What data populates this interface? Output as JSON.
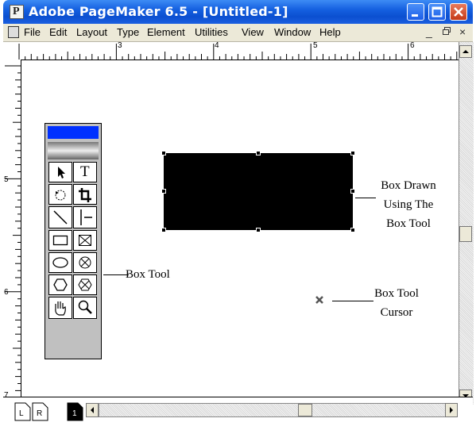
{
  "window": {
    "title": "Adobe PageMaker 6.5 - [Untitled-1]",
    "app_icon_letter": "P",
    "controls": [
      "minimize-icon",
      "maximize-icon",
      "close-icon"
    ]
  },
  "menubar": {
    "items": [
      "File",
      "Edit",
      "Layout",
      "Type",
      "Element",
      "Utilities",
      "View",
      "Window",
      "Help"
    ],
    "mdi_controls": [
      "_",
      "ɤ",
      "×"
    ]
  },
  "ruler": {
    "horizontal_labels": [
      "3",
      "4",
      "5",
      "6"
    ],
    "vertical_labels": [
      "5",
      "6",
      "7"
    ]
  },
  "toolbox": {
    "tools": [
      "pointer-tool",
      "text-tool",
      "rotate-tool",
      "crop-tool",
      "line-tool",
      "constrained-line-tool",
      "rectangle-tool",
      "rectangle-frame-tool",
      "ellipse-tool",
      "ellipse-frame-tool",
      "polygon-tool",
      "polygon-frame-tool",
      "hand-tool",
      "zoom-tool"
    ],
    "text_tool_glyph": "T"
  },
  "annotations": {
    "box_drawn": [
      "Box Drawn",
      "Using The",
      "Box Tool"
    ],
    "box_tool": "Box Tool",
    "box_tool_cursor": [
      "Box Tool",
      "Cursor"
    ]
  },
  "pages": {
    "left": "L",
    "right": "R",
    "current": "1"
  },
  "colors": {
    "titlebar": "#0b4fd0",
    "close_button": "#c53a18",
    "toolbox_header": "#0030ff",
    "menubar": "#ece9d8"
  }
}
